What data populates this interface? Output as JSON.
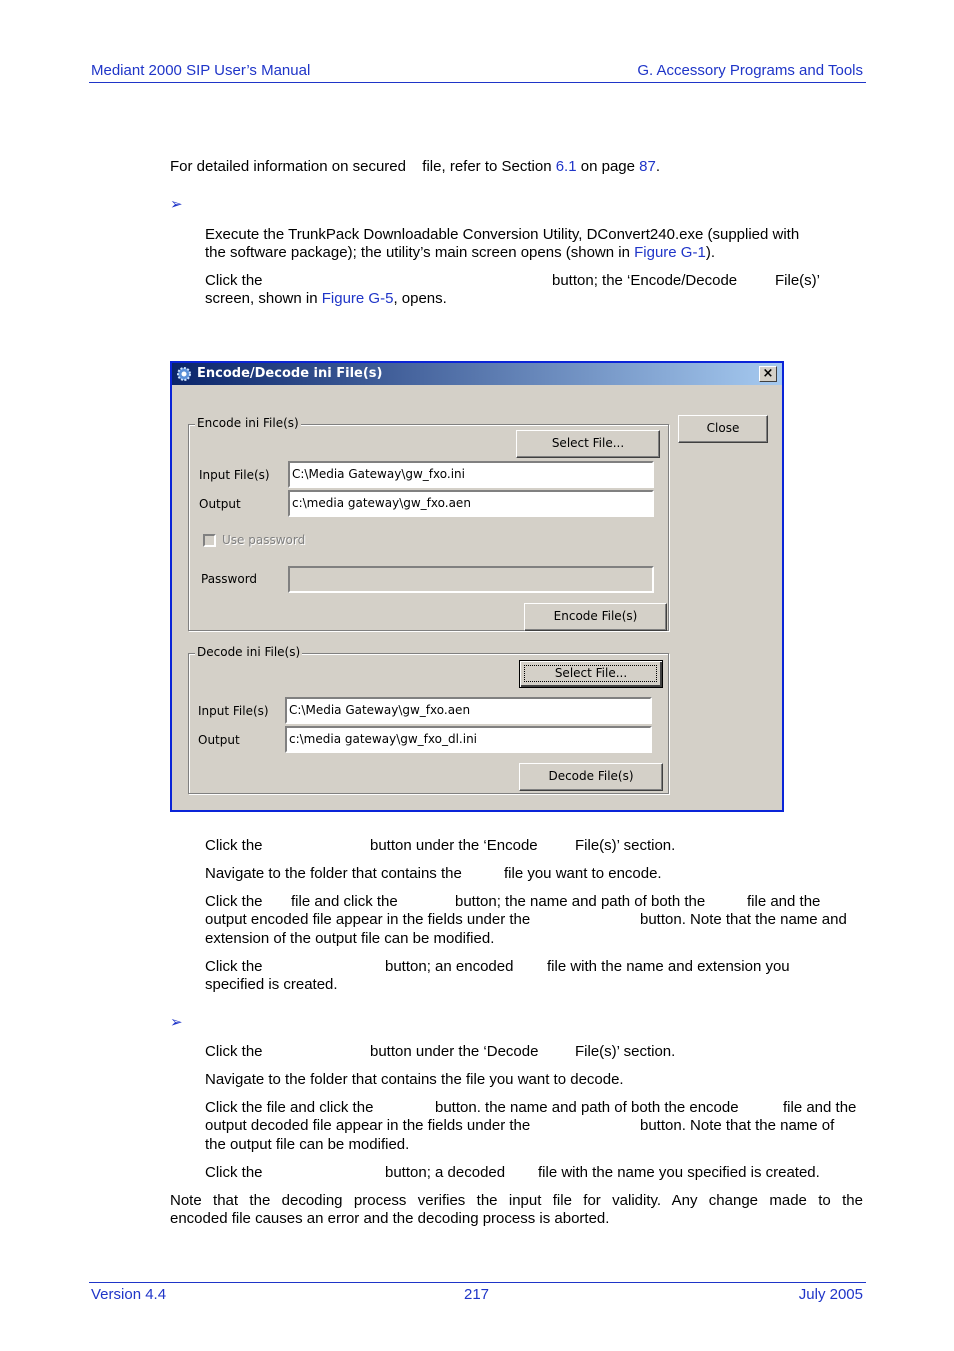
{
  "header": {
    "left": "Mediant 2000 SIP User’s Manual",
    "right": "G. Accessory Programs and Tools"
  },
  "intro": {
    "text_before": "For detailed information on secured ",
    "text_mid": " file, refer to Section ",
    "section_link": "6.1",
    "text_page": " on page ",
    "page_link": "87",
    "text_end": "."
  },
  "procedure1": {
    "bullet_icon": "arrowhead-icon",
    "steps": [
      {
        "line1": "Execute the TrunkPack Downloadable Conversion Utility, DConvert240.exe (supplied with",
        "line2_before": "the software package); the utility’s main screen opens (shown in ",
        "line2_link": "Figure G-1",
        "line2_after": ")."
      },
      {
        "line1_a": "Click the",
        "line1_b": "button; the ‘Encode/Decode",
        "line1_c": "File(s)’",
        "line2_before": "screen, shown in ",
        "line2_link": "Figure G-5",
        "line2_after": ", opens."
      }
    ]
  },
  "dialog": {
    "title": "Encode/Decode ini File(s)",
    "close_button": "Close",
    "close_x": "×",
    "encode": {
      "group_label": "Encode ini File(s)",
      "select_button": "Select File...",
      "input_label": "Input File(s)",
      "input_value": "C:\\Media Gateway\\gw_fxo.ini",
      "output_label": "Output",
      "output_value": "c:\\media gateway\\gw_fxo.aen",
      "use_password_label": "Use password",
      "use_password_checked": false,
      "password_label": "Password",
      "password_value": "",
      "encode_button": "Encode File(s)"
    },
    "decode": {
      "group_label": "Decode ini File(s)",
      "select_button": "Select File...",
      "input_label": "Input File(s)",
      "input_value": "C:\\Media Gateway\\gw_fxo.aen",
      "output_label": "Output",
      "output_value": "c:\\media gateway\\gw_fxo_dl.ini",
      "decode_button": "Decode File(s)"
    }
  },
  "encode_steps": [
    {
      "a": "Click the",
      "b": "button under the ‘Encode",
      "c": "File(s)’ section."
    },
    {
      "a": "Navigate to the folder that contains the",
      "b": "file you want to encode."
    },
    {
      "a": "Click the",
      "b": "file and click the",
      "c": "button; the name and path of both the",
      "d": "file and the",
      "line2_a": "output encoded file appear in the fields under the",
      "line2_b": "button. Note that the name and",
      "line3": "extension of the output file can be modified."
    },
    {
      "a": "Click the",
      "b": "button; an encoded",
      "c": "file with the name and extension you",
      "line2": "specified is created."
    }
  ],
  "procedure2": {
    "bullet_icon": "arrowhead-icon"
  },
  "decode_steps": [
    {
      "a": "Click the",
      "b": "button under the ‘Decode",
      "c": "File(s)’ section."
    },
    {
      "a": "Navigate to the folder that contains the file you want to decode."
    },
    {
      "a": "Click the file and click the",
      "b": "button. the name and path of both the encode",
      "c": "file and the",
      "line2_a": "output decoded file appear in the fields under the",
      "line2_b": "button. Note that the name of",
      "line3": "the output file can be modified."
    },
    {
      "a": "Click the",
      "b": "button; a decoded",
      "c": "file with the name you specified is created."
    }
  ],
  "note": {
    "line1": "Note that the decoding process verifies the input file for validity. Any change made to the",
    "line2": "encoded file causes an error and the decoding process is aborted."
  },
  "footer": {
    "left": "Version 4.4",
    "center": "217",
    "right": "July 2005"
  }
}
